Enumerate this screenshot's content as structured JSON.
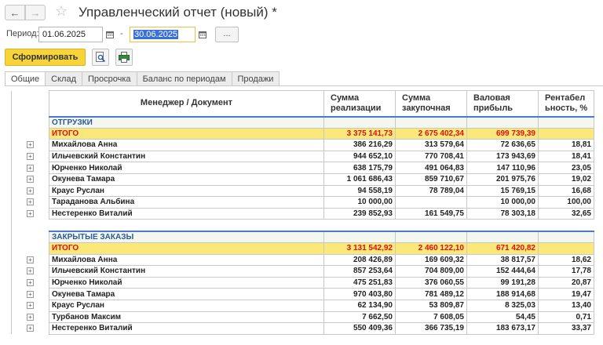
{
  "window": {
    "title": "Управленческий отчет (новый) *"
  },
  "nav": {
    "back": "←",
    "forward": "→"
  },
  "period": {
    "label": "Период:",
    "from": "01.06.2025",
    "to": "30.06.2025",
    "dash": "-",
    "dots": "..."
  },
  "toolbar": {
    "generate_label": "Сформировать"
  },
  "tabs": [
    "Общие",
    "Склад",
    "Просрочка",
    "Баланс по периодам",
    "Продажи"
  ],
  "columns": {
    "manager": "Менеджер / Документ",
    "sales": [
      "Сумма",
      "реализации"
    ],
    "purchase": [
      "Сумма",
      "закупочная"
    ],
    "profit": [
      "Валовая",
      "прибыль"
    ],
    "margin": [
      "Рентабел",
      "ьность, %"
    ]
  },
  "sections": [
    {
      "title": "ОТГРУЗКИ",
      "total": {
        "label": "ИТОГО",
        "sales": "3 375 141,73",
        "purchase": "2 675 402,34",
        "profit": "699 739,39",
        "margin": ""
      },
      "rows": [
        {
          "name": "Михайлова Анна",
          "sales": "386 216,29",
          "purchase": "313 579,64",
          "profit": "72 636,65",
          "margin": "18,81"
        },
        {
          "name": "Ильчевский Константин",
          "sales": "944 652,10",
          "purchase": "770 708,41",
          "profit": "173 943,69",
          "margin": "18,41"
        },
        {
          "name": "Юрченко Николай",
          "sales": "638 175,79",
          "purchase": "491 064,83",
          "profit": "147 110,96",
          "margin": "23,05"
        },
        {
          "name": "Окунева Тамара",
          "sales": "1 061 686,43",
          "purchase": "859 710,67",
          "profit": "201 975,76",
          "margin": "19,02"
        },
        {
          "name": "Краус Руслан",
          "sales": "94 558,19",
          "purchase": "78 789,04",
          "profit": "15 769,15",
          "margin": "16,68"
        },
        {
          "name": "Тараданова Альбина",
          "sales": "10 000,00",
          "purchase": "",
          "profit": "10 000,00",
          "margin": "100,00"
        },
        {
          "name": "Нестеренко Виталий",
          "sales": "239 852,93",
          "purchase": "161 549,75",
          "profit": "78 303,18",
          "margin": "32,65"
        }
      ]
    },
    {
      "title": "ЗАКРЫТЫЕ ЗАКАЗЫ",
      "total": {
        "label": "ИТОГО",
        "sales": "3 131 542,92",
        "purchase": "2 460 122,10",
        "profit": "671 420,82",
        "margin": ""
      },
      "rows": [
        {
          "name": "Михайлова Анна",
          "sales": "208 426,89",
          "purchase": "169 609,32",
          "profit": "38 817,57",
          "margin": "18,62"
        },
        {
          "name": "Ильчевский Константин",
          "sales": "857 253,64",
          "purchase": "704 809,00",
          "profit": "152 444,64",
          "margin": "17,78"
        },
        {
          "name": "Юрченко Николай",
          "sales": "475 251,83",
          "purchase": "376 060,55",
          "profit": "99 191,28",
          "margin": "20,87"
        },
        {
          "name": "Окунева Тамара",
          "sales": "970 403,80",
          "purchase": "781 489,12",
          "profit": "188 914,68",
          "margin": "19,47"
        },
        {
          "name": "Краус Руслан",
          "sales": "62 134,90",
          "purchase": "53 809,87",
          "profit": "8 325,03",
          "margin": "13,40"
        },
        {
          "name": "Турбанов Максим",
          "sales": "7 662,50",
          "purchase": "7 608,05",
          "profit": "54,45",
          "margin": "0,71"
        },
        {
          "name": "Нестеренко Виталий",
          "sales": "550 409,36",
          "purchase": "366 735,19",
          "profit": "183 673,17",
          "margin": "33,37"
        }
      ]
    }
  ]
}
